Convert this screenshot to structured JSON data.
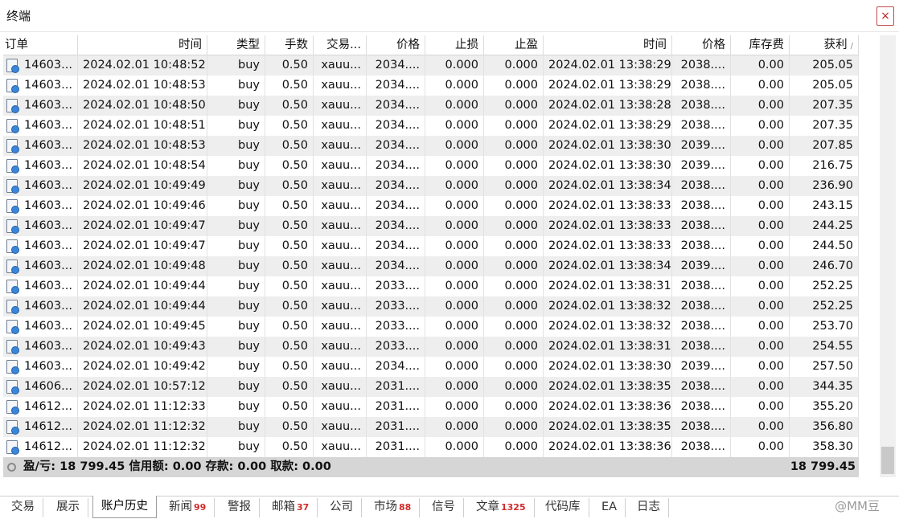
{
  "window": {
    "title": "终端",
    "close_glyph": "×"
  },
  "columns": [
    "订单",
    "时间",
    "类型",
    "手数",
    "交易...",
    "价格",
    "止损",
    "止盈",
    "时间",
    "价格",
    "库存费",
    "获利"
  ],
  "sort_glyph": "/",
  "rows": [
    [
      "14603...",
      "2024.02.01 10:48:52",
      "buy",
      "0.50",
      "xauu...",
      "2034....",
      "0.000",
      "0.000",
      "2024.02.01 13:38:29",
      "2038....",
      "0.00",
      "205.05"
    ],
    [
      "14603...",
      "2024.02.01 10:48:53",
      "buy",
      "0.50",
      "xauu...",
      "2034....",
      "0.000",
      "0.000",
      "2024.02.01 13:38:29",
      "2038....",
      "0.00",
      "205.05"
    ],
    [
      "14603...",
      "2024.02.01 10:48:50",
      "buy",
      "0.50",
      "xauu...",
      "2034....",
      "0.000",
      "0.000",
      "2024.02.01 13:38:28",
      "2038....",
      "0.00",
      "207.35"
    ],
    [
      "14603...",
      "2024.02.01 10:48:51",
      "buy",
      "0.50",
      "xauu...",
      "2034....",
      "0.000",
      "0.000",
      "2024.02.01 13:38:29",
      "2038....",
      "0.00",
      "207.35"
    ],
    [
      "14603...",
      "2024.02.01 10:48:53",
      "buy",
      "0.50",
      "xauu...",
      "2034....",
      "0.000",
      "0.000",
      "2024.02.01 13:38:30",
      "2039....",
      "0.00",
      "207.85"
    ],
    [
      "14603...",
      "2024.02.01 10:48:54",
      "buy",
      "0.50",
      "xauu...",
      "2034....",
      "0.000",
      "0.000",
      "2024.02.01 13:38:30",
      "2039....",
      "0.00",
      "216.75"
    ],
    [
      "14603...",
      "2024.02.01 10:49:49",
      "buy",
      "0.50",
      "xauu...",
      "2034....",
      "0.000",
      "0.000",
      "2024.02.01 13:38:34",
      "2038....",
      "0.00",
      "236.90"
    ],
    [
      "14603...",
      "2024.02.01 10:49:46",
      "buy",
      "0.50",
      "xauu...",
      "2034....",
      "0.000",
      "0.000",
      "2024.02.01 13:38:33",
      "2038....",
      "0.00",
      "243.15"
    ],
    [
      "14603...",
      "2024.02.01 10:49:47",
      "buy",
      "0.50",
      "xauu...",
      "2034....",
      "0.000",
      "0.000",
      "2024.02.01 13:38:33",
      "2038....",
      "0.00",
      "244.25"
    ],
    [
      "14603...",
      "2024.02.01 10:49:47",
      "buy",
      "0.50",
      "xauu...",
      "2034....",
      "0.000",
      "0.000",
      "2024.02.01 13:38:33",
      "2038....",
      "0.00",
      "244.50"
    ],
    [
      "14603...",
      "2024.02.01 10:49:48",
      "buy",
      "0.50",
      "xauu...",
      "2034....",
      "0.000",
      "0.000",
      "2024.02.01 13:38:34",
      "2039....",
      "0.00",
      "246.70"
    ],
    [
      "14603...",
      "2024.02.01 10:49:44",
      "buy",
      "0.50",
      "xauu...",
      "2033....",
      "0.000",
      "0.000",
      "2024.02.01 13:38:31",
      "2038....",
      "0.00",
      "252.25"
    ],
    [
      "14603...",
      "2024.02.01 10:49:44",
      "buy",
      "0.50",
      "xauu...",
      "2033....",
      "0.000",
      "0.000",
      "2024.02.01 13:38:32",
      "2038....",
      "0.00",
      "252.25"
    ],
    [
      "14603...",
      "2024.02.01 10:49:45",
      "buy",
      "0.50",
      "xauu...",
      "2033....",
      "0.000",
      "0.000",
      "2024.02.01 13:38:32",
      "2038....",
      "0.00",
      "253.70"
    ],
    [
      "14603...",
      "2024.02.01 10:49:43",
      "buy",
      "0.50",
      "xauu...",
      "2033....",
      "0.000",
      "0.000",
      "2024.02.01 13:38:31",
      "2038....",
      "0.00",
      "254.55"
    ],
    [
      "14603...",
      "2024.02.01 10:49:42",
      "buy",
      "0.50",
      "xauu...",
      "2034....",
      "0.000",
      "0.000",
      "2024.02.01 13:38:30",
      "2039....",
      "0.00",
      "257.50"
    ],
    [
      "14606...",
      "2024.02.01 10:57:12",
      "buy",
      "0.50",
      "xauu...",
      "2031....",
      "0.000",
      "0.000",
      "2024.02.01 13:38:35",
      "2038....",
      "0.00",
      "344.35"
    ],
    [
      "14612...",
      "2024.02.01 11:12:33",
      "buy",
      "0.50",
      "xauu...",
      "2031....",
      "0.000",
      "0.000",
      "2024.02.01 13:38:36",
      "2038....",
      "0.00",
      "355.20"
    ],
    [
      "14612...",
      "2024.02.01 11:12:32",
      "buy",
      "0.50",
      "xauu...",
      "2031....",
      "0.000",
      "0.000",
      "2024.02.01 13:38:35",
      "2038....",
      "0.00",
      "356.80"
    ],
    [
      "14612...",
      "2024.02.01 11:12:32",
      "buy",
      "0.50",
      "xauu...",
      "2031....",
      "0.000",
      "0.000",
      "2024.02.01 13:38:36",
      "2038....",
      "0.00",
      "358.30"
    ]
  ],
  "summary": {
    "text": "盈/亏: 18 799.45  信用额: 0.00  存款: 0.00  取款: 0.00",
    "total": "18 799.45"
  },
  "tabs": [
    {
      "label": "交易",
      "badge": ""
    },
    {
      "label": "展示",
      "badge": ""
    },
    {
      "label": "账户历史",
      "badge": "",
      "active": true
    },
    {
      "label": "新闻",
      "badge": "99"
    },
    {
      "label": "警报",
      "badge": ""
    },
    {
      "label": "邮箱",
      "badge": "37"
    },
    {
      "label": "公司",
      "badge": ""
    },
    {
      "label": "市场",
      "badge": "88"
    },
    {
      "label": "信号",
      "badge": ""
    },
    {
      "label": "文章",
      "badge": "1325"
    },
    {
      "label": "代码库",
      "badge": ""
    },
    {
      "label": "EA",
      "badge": ""
    },
    {
      "label": "日志",
      "badge": ""
    }
  ],
  "watermark": "@MM豆",
  "colors": {
    "alt_row": "#eeeeee",
    "summary_bg": "#d6d6d6",
    "badge": "#d12b2b"
  }
}
